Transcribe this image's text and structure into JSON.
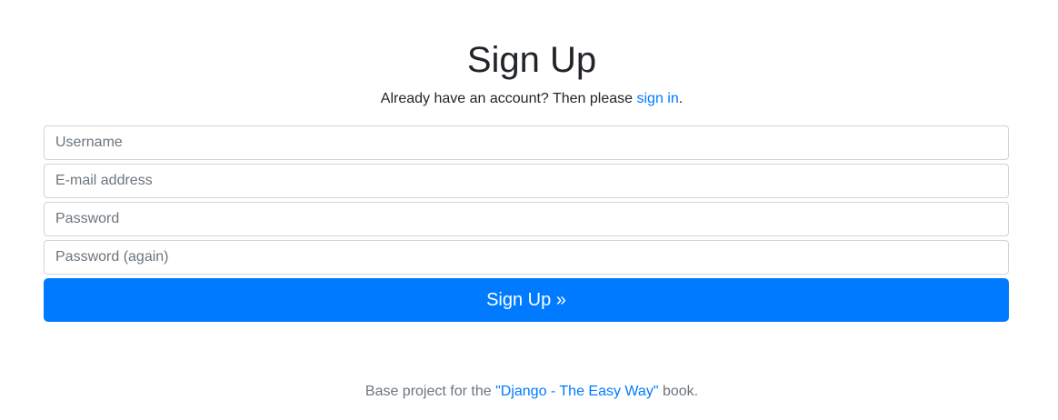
{
  "page": {
    "title": "Sign Up"
  },
  "signin_prompt": {
    "prefix": "Already have an account? Then please ",
    "link_label": "sign in",
    "suffix": "."
  },
  "form": {
    "username_placeholder": "Username",
    "email_placeholder": "E-mail address",
    "password_placeholder": "Password",
    "password_again_placeholder": "Password (again)",
    "username_value": "",
    "email_value": "",
    "password_value": "",
    "password_again_value": "",
    "submit_label": "Sign Up »"
  },
  "footer": {
    "prefix": "Base project for the ",
    "link_label": "\"Django - The Easy Way\"",
    "suffix": " book."
  },
  "colors": {
    "primary": "#007bff",
    "text": "#212529",
    "muted": "#6c757d",
    "border": "#ced4da"
  }
}
